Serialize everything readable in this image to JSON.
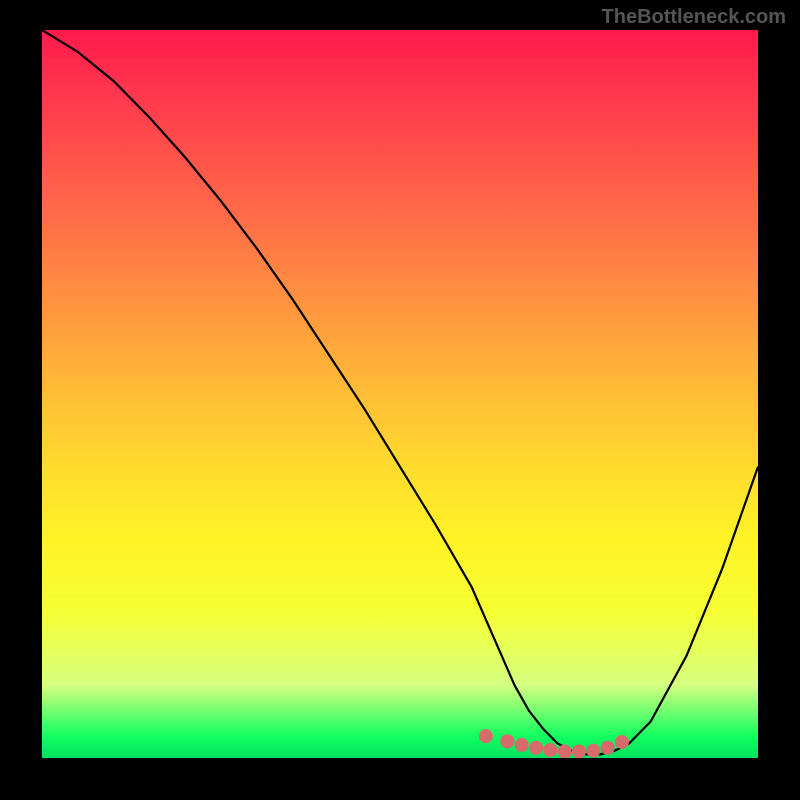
{
  "watermark": "TheBottleneck.com",
  "chart_data": {
    "type": "line",
    "title": "",
    "xlabel": "",
    "ylabel": "",
    "xlim": [
      0,
      100
    ],
    "ylim": [
      0,
      100
    ],
    "series": [
      {
        "name": "curve",
        "x": [
          0,
          5,
          10,
          15,
          20,
          25,
          30,
          35,
          40,
          45,
          50,
          55,
          60,
          62,
          64,
          66,
          68,
          70,
          72,
          74,
          76,
          78,
          80,
          82,
          85,
          90,
          95,
          100
        ],
        "y": [
          100,
          97,
          93,
          88,
          82.5,
          76.5,
          70,
          63,
          55.5,
          48,
          40,
          32,
          23.5,
          19,
          14.5,
          10,
          6.5,
          4,
          2,
          1,
          0.5,
          0.5,
          1,
          2,
          5,
          14,
          26,
          40
        ]
      }
    ],
    "markers": {
      "x": [
        62,
        65,
        67,
        69,
        71,
        73,
        75,
        77,
        79,
        81
      ],
      "y": [
        3,
        2.3,
        1.8,
        1.4,
        1.1,
        0.9,
        0.9,
        1.0,
        1.4,
        2.2
      ],
      "color": "#d86a6a",
      "size": 7
    },
    "gradient_stops": [
      {
        "pos": 0.0,
        "color": "#ff1a4d"
      },
      {
        "pos": 0.5,
        "color": "#ffbd36"
      },
      {
        "pos": 0.8,
        "color": "#f5ff33"
      },
      {
        "pos": 0.97,
        "color": "#12ff60"
      },
      {
        "pos": 1.0,
        "color": "#00e060"
      }
    ]
  }
}
